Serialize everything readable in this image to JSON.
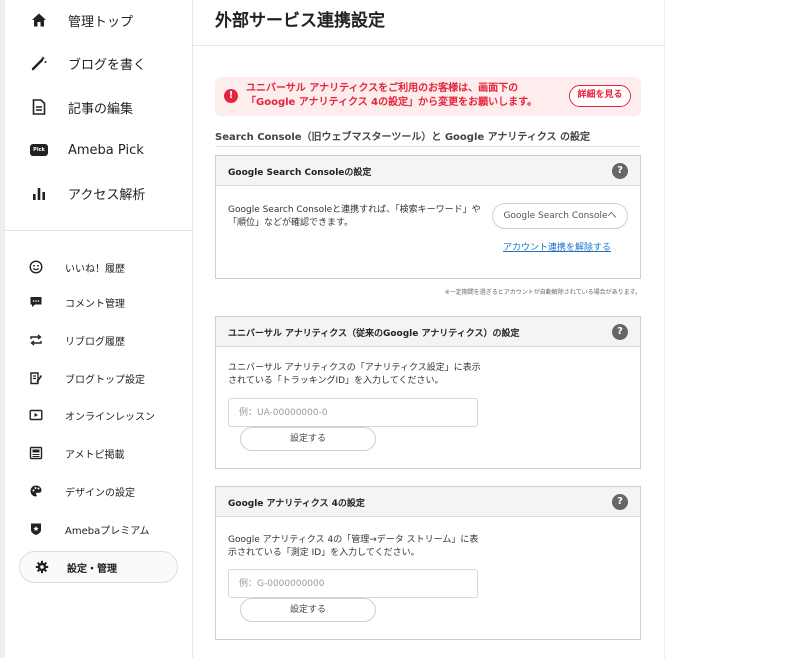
{
  "sidebar": {
    "main_items": [
      {
        "label": "管理トップ",
        "icon": "home-icon"
      },
      {
        "label": "ブログを書く",
        "icon": "magic-pen-icon"
      },
      {
        "label": "記事の編集",
        "icon": "document-icon"
      },
      {
        "label": "Ameba Pick",
        "icon": "pick-badge-icon",
        "badge": "Pick"
      },
      {
        "label": "アクセス解析",
        "icon": "bar-chart-icon"
      }
    ],
    "sub_items": [
      {
        "label": "いいね！履歴",
        "icon": "smile-icon"
      },
      {
        "label": "コメント管理",
        "icon": "comment-icon"
      },
      {
        "label": "リブログ履歴",
        "icon": "reblog-icon"
      },
      {
        "label": "ブログトップ設定",
        "icon": "edit-page-icon"
      },
      {
        "label": "オンラインレッスン",
        "icon": "video-icon"
      },
      {
        "label": "アメトピ掲載",
        "icon": "news-icon"
      },
      {
        "label": "デザインの設定",
        "icon": "palette-icon"
      },
      {
        "label": "Amebaプレミアム",
        "icon": "premium-shield-icon"
      },
      {
        "label": "設定・管理",
        "icon": "gear-icon",
        "active": true
      }
    ]
  },
  "main": {
    "title": "外部サービス連携設定",
    "alert": {
      "line1": "ユニバーサル アナリティクスをご利用のお客様は、画面下の",
      "line2": "「Google アナリティクス 4の設定」から変更をお願いします。",
      "button_label": "詳細を見る",
      "color": "#e5243b"
    },
    "section_heading": "Search Console（旧ウェブマスターツール）と Google アナリティクス の設定",
    "gsc": {
      "title": "Google Search Consoleの設定",
      "text1": "Google Search Consoleと連携すれば、「検索キーワード」や",
      "text2": "「順位」などが確認できます。",
      "button_label": "Google Search Consoleへ",
      "unlink_label": "アカウント連携を解除する"
    },
    "note": "※一定期間を過ぎるとアカウントが自動解除されている場合があります。",
    "ua": {
      "title": "ユニバーサル アナリティクス（従来のGoogle アナリティクス）の設定",
      "text1": "ユニバーサル アナリティクスの「アナリティクス設定」に表示",
      "text2": "されている「トラッキングID」を入力してください。",
      "placeholder": "例：UA-00000000-0",
      "button_label": "設定する"
    },
    "ga4": {
      "title": "Google アナリティクス 4の設定",
      "text1": "Google アナリティクス 4の「管理→データ ストリーム」に表",
      "text2": "示されている「測定 ID」を入力してください。",
      "placeholder": "例：G-0000000000",
      "button_label": "設定する"
    },
    "help_label": "?"
  }
}
